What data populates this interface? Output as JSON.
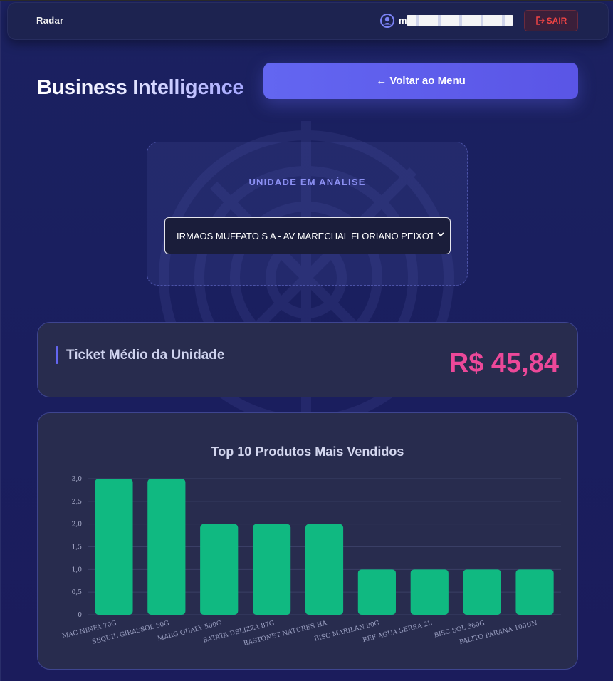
{
  "navbar": {
    "brand": "Radar",
    "user_name": "m",
    "logout_label": "SAIR"
  },
  "header": {
    "title": "Business Intelligence",
    "back_label": "← Voltar ao Menu"
  },
  "unit": {
    "label": "UNIDADE EM ANÁLISE",
    "selected": "IRMAOS MUFFATO S A - AV MARECHAL FLORIANO PEIXOTO"
  },
  "ticket": {
    "label": "Ticket Médio da Unidade",
    "value": "R$ 45,84"
  },
  "colors": {
    "accent": "#6366f1",
    "ticket_value": "#ec4899",
    "bar": "#10b981",
    "logout": "#ef4444"
  },
  "chart_data": {
    "type": "bar",
    "title": "Top 10 Produtos Mais Vendidos",
    "categories": [
      "MAC NINFA 70G",
      "SEQUIL GIRASSOL 50G",
      "MARG QUALY 500G",
      "BATATA DELIZZA 87G",
      "BASTONET NATURES HA",
      "BISC MARILAN 80G",
      "REF AGUA SERRA 2L",
      "BISC SOL 360G",
      "PALITO PARANA 100UN"
    ],
    "values": [
      3,
      3,
      2,
      2,
      2,
      1,
      1,
      1,
      1
    ],
    "ylim": [
      0,
      3
    ],
    "yticks": [
      "0",
      "0,5",
      "1,0",
      "1,5",
      "2,0",
      "2,5",
      "3,0"
    ],
    "grid": true,
    "xlabel": "",
    "ylabel": ""
  }
}
